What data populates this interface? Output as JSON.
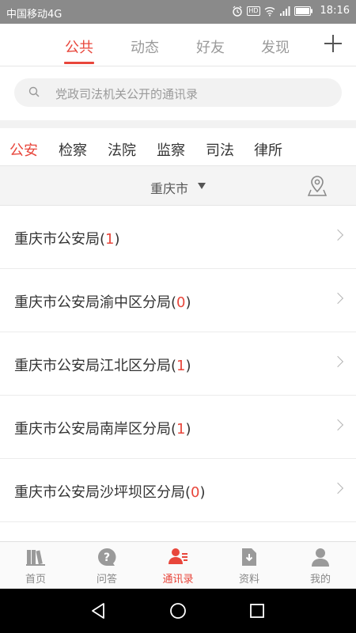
{
  "status_bar": {
    "carrier": "中国移动4G",
    "hd": "HD",
    "signal_label": "4G",
    "time": "18:16"
  },
  "top_tabs": [
    "公共",
    "动态",
    "好友",
    "发现"
  ],
  "active_top_tab": 0,
  "search": {
    "placeholder": "党政司法机关公开的通讯录"
  },
  "categories": [
    "公安",
    "检察",
    "法院",
    "监察",
    "司法",
    "律所"
  ],
  "active_category": 0,
  "city": {
    "name": "重庆市"
  },
  "list": [
    {
      "name": "重庆市公安局",
      "count": "1"
    },
    {
      "name": "重庆市公安局渝中区分局",
      "count": "0"
    },
    {
      "name": "重庆市公安局江北区分局",
      "count": "1"
    },
    {
      "name": "重庆市公安局南岸区分局",
      "count": "1"
    },
    {
      "name": "重庆市公安局沙坪坝区分局",
      "count": "0"
    }
  ],
  "bottom_tabs": [
    {
      "label": "首页",
      "icon": "books-icon"
    },
    {
      "label": "问答",
      "icon": "question-icon"
    },
    {
      "label": "通讯录",
      "icon": "contacts-icon"
    },
    {
      "label": "资料",
      "icon": "document-download-icon"
    },
    {
      "label": "我的",
      "icon": "person-icon"
    }
  ],
  "active_bottom_tab": 2,
  "colors": {
    "accent": "#e8463b",
    "status_bar": "#8a8a8a"
  }
}
